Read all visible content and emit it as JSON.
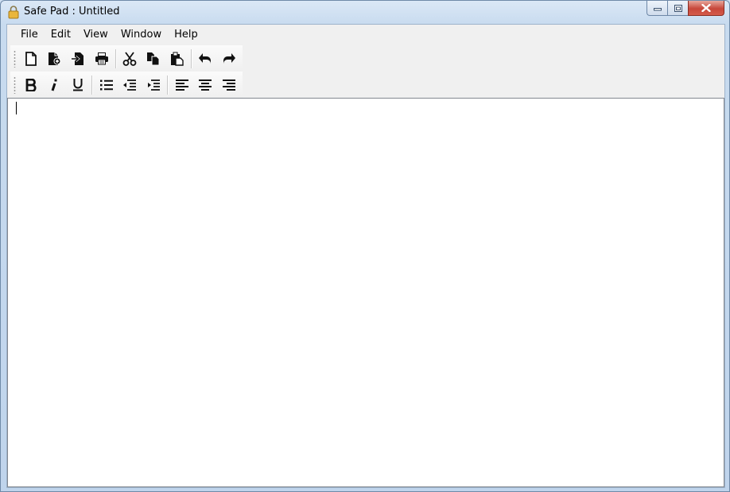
{
  "window": {
    "title": "Safe Pad : Untitled",
    "app_icon": "lock-icon",
    "controls": [
      "minimize-icon",
      "restore-icon",
      "close-icon"
    ]
  },
  "menu": {
    "items": [
      "File",
      "Edit",
      "View",
      "Window",
      "Help"
    ]
  },
  "toolbar_main": {
    "buttons": [
      "new-document-icon",
      "open-document-icon",
      "import-icon",
      "print-icon",
      "cut-icon",
      "copy-icon",
      "paste-icon",
      "undo-icon",
      "redo-icon"
    ]
  },
  "toolbar_format": {
    "buttons": [
      "bold-icon",
      "italic-icon",
      "underline-icon",
      "bulleted-list-icon",
      "decrease-indent-icon",
      "increase-indent-icon",
      "align-left-icon",
      "align-center-icon",
      "align-right-icon"
    ]
  },
  "editor": {
    "content": ""
  },
  "colors": {
    "frame": "#bfd4ec",
    "close_button": "#c7473a",
    "client_bg": "#f0f0f0"
  }
}
